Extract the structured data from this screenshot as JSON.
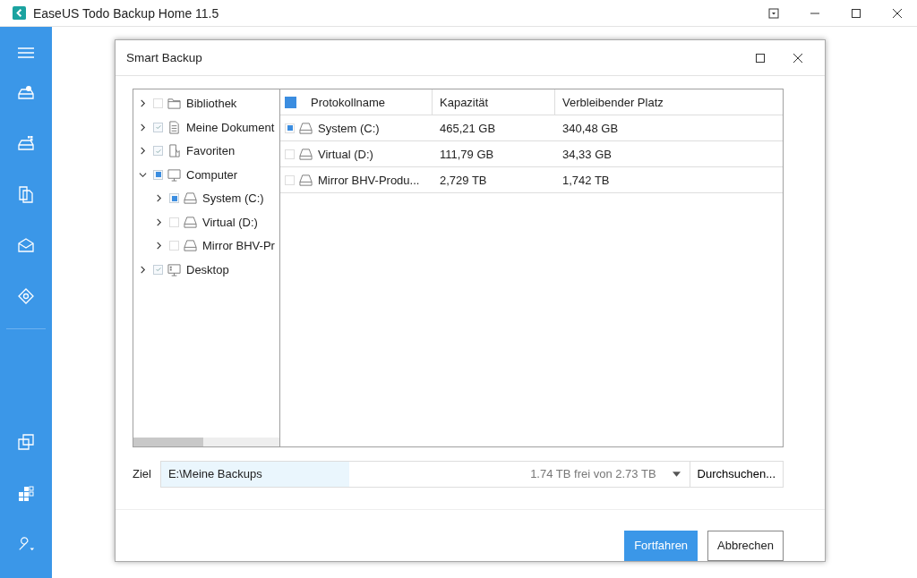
{
  "window": {
    "title": "EaseUS Todo Backup Home 11.5"
  },
  "dialog": {
    "title": "Smart Backup",
    "tree": [
      {
        "label": "Bibliothek",
        "kind": "folder",
        "checked": false,
        "partial": false,
        "expanded": false
      },
      {
        "label": "Meine Dokument",
        "kind": "document",
        "checked": true,
        "partial": false,
        "expanded": false
      },
      {
        "label": "Favoriten",
        "kind": "favorites",
        "checked": true,
        "partial": false,
        "expanded": false
      },
      {
        "label": "Computer",
        "kind": "computer",
        "checked": true,
        "partial": true,
        "expanded": true,
        "children": [
          {
            "label": "System (C:)",
            "kind": "drive",
            "checked": true,
            "partial": true,
            "expanded": false
          },
          {
            "label": "Virtual (D:)",
            "kind": "drive",
            "checked": false,
            "partial": false,
            "expanded": false
          },
          {
            "label": "Mirror BHV-Pr",
            "kind": "drive",
            "checked": false,
            "partial": false,
            "expanded": false
          }
        ]
      },
      {
        "label": "Desktop",
        "kind": "desktop",
        "checked": true,
        "partial": false,
        "expanded": false
      }
    ],
    "table": {
      "all_checked": true,
      "columns": [
        "Protokollname",
        "Kapazität",
        "Verbleibender Platz"
      ],
      "rows": [
        {
          "checked": true,
          "cells": [
            "System (C:)",
            "465,21 GB",
            "340,48 GB"
          ]
        },
        {
          "checked": false,
          "cells": [
            "Virtual (D:)",
            "111,79 GB",
            "34,33 GB"
          ]
        },
        {
          "checked": false,
          "cells": [
            "Mirror BHV-Produ...",
            "2,729 TB",
            "1,742 TB"
          ]
        }
      ]
    },
    "target": {
      "label": "Ziel",
      "value": "E:\\Meine Backups",
      "space": "1.74 TB frei von 2.73 TB",
      "browse": "Durchsuchen..."
    },
    "buttons": [
      {
        "label": "Fortfahren",
        "primary": true
      },
      {
        "label": "Abbrechen",
        "primary": false
      }
    ]
  }
}
